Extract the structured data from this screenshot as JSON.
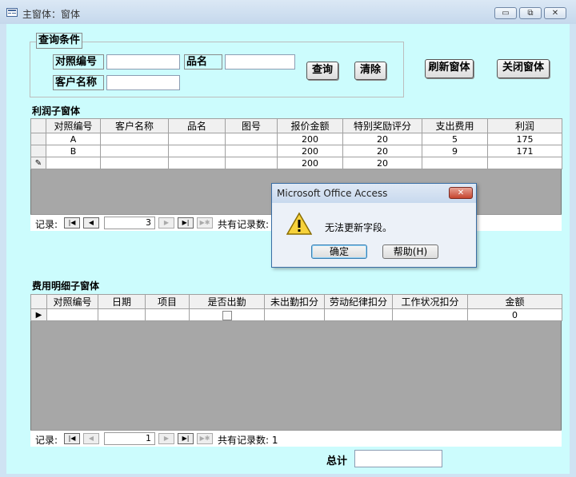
{
  "window": {
    "title": "主窗体：窗体",
    "minimize_label": "▭",
    "restore_label": "⧉",
    "close_label": "✕"
  },
  "query": {
    "group_label": "查询条件",
    "ref_label": "对照编号",
    "ref_value": "",
    "product_label": "品名",
    "product_value": "",
    "customer_label": "客户名称",
    "customer_value": "",
    "search_btn": "查询",
    "clear_btn": "清除"
  },
  "toolbar": {
    "refresh_btn": "刷新窗体",
    "close_btn": "关闭窗体"
  },
  "profit": {
    "title": "利润子窗体",
    "columns": [
      "对照编号",
      "客户名称",
      "品名",
      "图号",
      "报价金额",
      "特别奖励评分",
      "支出费用",
      "利润"
    ],
    "rows": [
      [
        "A",
        "",
        "",
        "",
        "200",
        "20",
        "5",
        "175"
      ],
      [
        "B",
        "",
        "",
        "",
        "200",
        "20",
        "9",
        "171"
      ],
      [
        "",
        "",
        "",
        "",
        "200",
        "20",
        "",
        ""
      ]
    ],
    "nav": {
      "record_label": "记录:",
      "current": "3",
      "total_label": "共有记录数:"
    }
  },
  "expense": {
    "title": "费用明细子窗体",
    "columns": [
      "对照编号",
      "日期",
      "项目",
      "是否出勤",
      "未出勤扣分",
      "劳动纪律扣分",
      "工作状况扣分",
      "金额"
    ],
    "rows": [
      [
        "",
        "",
        "",
        "",
        "",
        "",
        "",
        "0"
      ]
    ],
    "nav": {
      "record_label": "记录:",
      "current": "1",
      "total_label": "共有记录数: 1"
    }
  },
  "total": {
    "label": "总计",
    "value": ""
  },
  "dialog": {
    "title": "Microsoft Office Access",
    "message": "无法更新字段。",
    "ok_btn": "确定",
    "help_btn": "帮助(H)",
    "icon": "warning-icon"
  }
}
